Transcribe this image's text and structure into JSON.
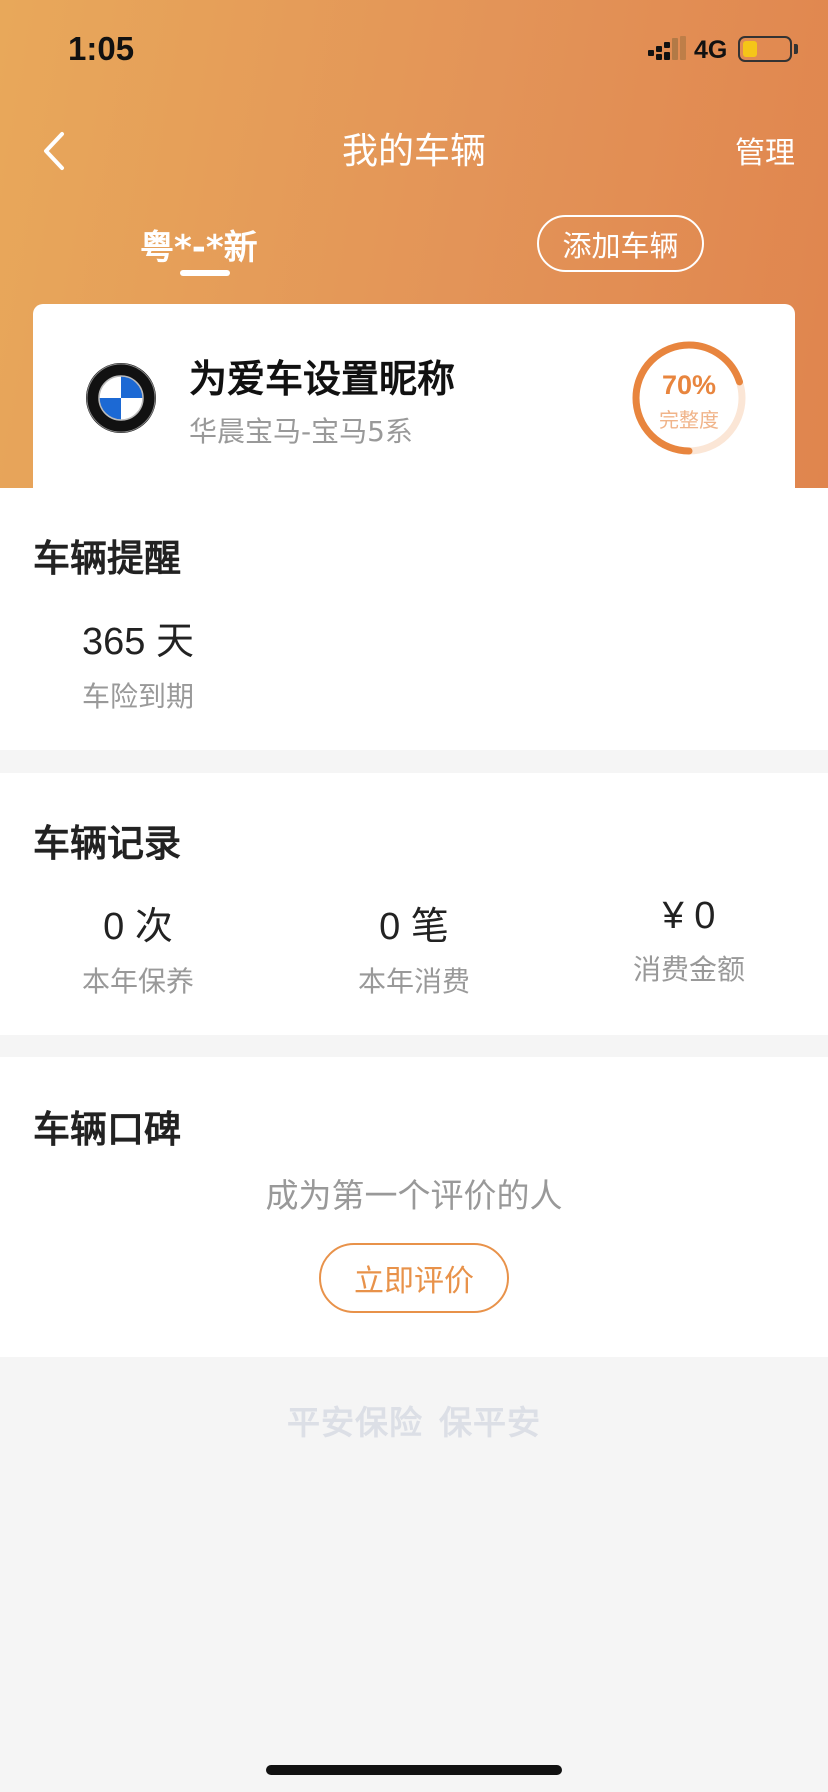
{
  "status_bar": {
    "time": "1:05",
    "network": "4G"
  },
  "nav": {
    "title": "我的车辆",
    "manage_label": "管理"
  },
  "plate_tab": {
    "label": "粤*-*新"
  },
  "add_vehicle_label": "添加车辆",
  "car": {
    "brand_logo": "bmw-logo",
    "nickname": "为爱车设置昵称",
    "model": "华晨宝马-宝马5系",
    "completeness_value": 70,
    "completeness_percent": "70%",
    "completeness_label": "完整度"
  },
  "reminder": {
    "title": "车辆提醒",
    "items": [
      {
        "value": "365 天",
        "label": "车险到期"
      }
    ]
  },
  "records": {
    "title": "车辆记录",
    "items": [
      {
        "value": "0 次",
        "label": "本年保养"
      },
      {
        "value": "0 笔",
        "label": "本年消费"
      },
      {
        "value": "¥ 0",
        "label": "消费金额"
      }
    ]
  },
  "reviews": {
    "title": "车辆口碑",
    "empty_text": "成为第一个评价的人",
    "button_label": "立即评价"
  },
  "slogan": {
    "part1": "平安保险",
    "part2": "保平安"
  },
  "colors": {
    "accent": "#e8924a",
    "hero_start": "#e8a85a",
    "hero_end": "#e0854e"
  }
}
